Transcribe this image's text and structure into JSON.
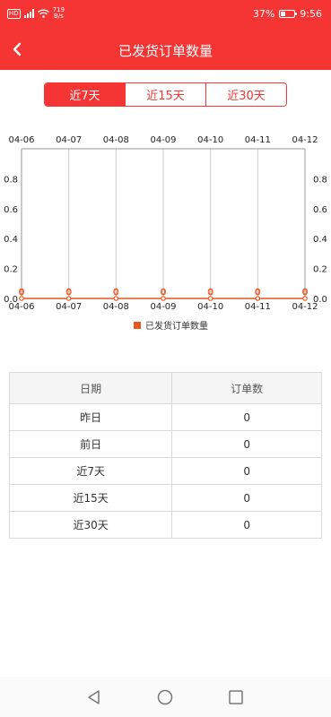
{
  "status_bar": {
    "network_tag": "HD",
    "net_speed_value": "719",
    "net_speed_unit": "B/s",
    "battery_percent": "37%",
    "battery_level": 0.37,
    "time": "9:56"
  },
  "header": {
    "title": "已发货订单数量",
    "back_icon": "chevron-left-icon"
  },
  "range_tabs": {
    "items": [
      {
        "label": "近7天",
        "active": true
      },
      {
        "label": "近15天",
        "active": false
      },
      {
        "label": "近30天",
        "active": false
      }
    ]
  },
  "chart_data": {
    "type": "line",
    "categories": [
      "04-06",
      "04-07",
      "04-08",
      "04-09",
      "04-10",
      "04-11",
      "04-12"
    ],
    "series": [
      {
        "name": "已发货订单数量",
        "values": [
          0,
          0,
          0,
          0,
          0,
          0,
          0
        ],
        "color": "#e8561e"
      }
    ],
    "ylim": [
      0,
      1
    ],
    "y_ticks": [
      "0.0",
      "0.2",
      "0.4",
      "0.6",
      "0.8"
    ],
    "grid": "vertical",
    "axes": "left-right-top-bottom",
    "legend_position": "bottom-center",
    "data_labels": [
      "0",
      "0",
      "0",
      "0",
      "0",
      "0",
      "0"
    ]
  },
  "table": {
    "headers": [
      "日期",
      "订单数"
    ],
    "rows": [
      [
        "昨日",
        "0"
      ],
      [
        "前日",
        "0"
      ],
      [
        "近7天",
        "0"
      ],
      [
        "近15天",
        "0"
      ],
      [
        "近30天",
        "0"
      ]
    ]
  },
  "system_nav": {
    "back": "triangle-back-icon",
    "home": "circle-home-icon",
    "recent": "square-recent-icon"
  }
}
